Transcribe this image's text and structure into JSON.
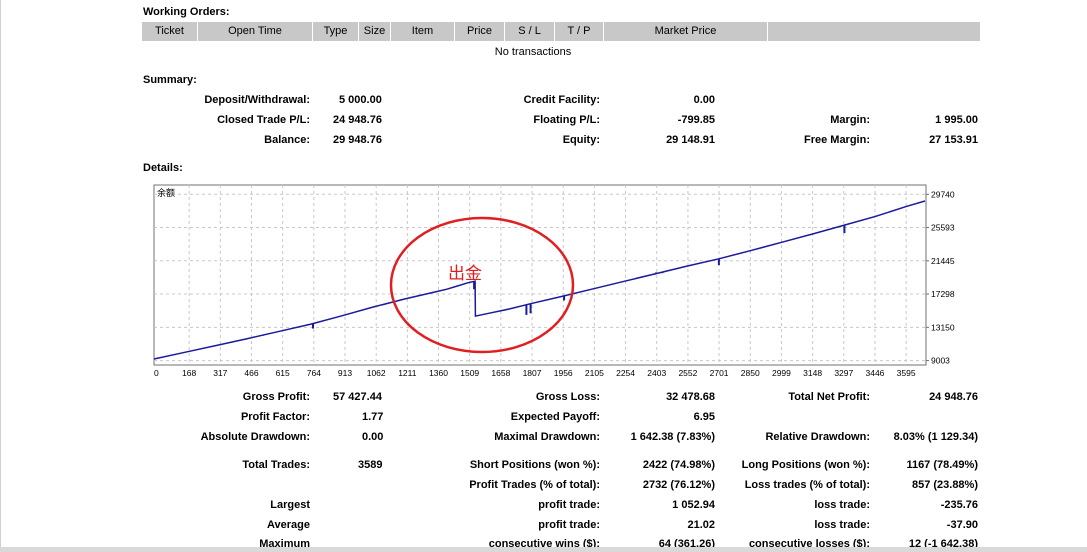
{
  "working_orders": {
    "title": "Working Orders:",
    "columns": [
      "Ticket",
      "Open Time",
      "Type",
      "Size",
      "Item",
      "Price",
      "S / L",
      "T / P",
      "Market Price",
      ""
    ],
    "empty_text": "No transactions"
  },
  "summary": {
    "title": "Summary:",
    "deposit_label": "Deposit/Withdrawal:",
    "deposit_value": "5 000.00",
    "credit_label": "Credit Facility:",
    "credit_value": "0.00",
    "closed_label": "Closed Trade P/L:",
    "closed_value": "24 948.76",
    "floating_label": "Floating P/L:",
    "floating_value": "-799.85",
    "margin_label": "Margin:",
    "margin_value": "1 995.00",
    "balance_label": "Balance:",
    "balance_value": "29 948.76",
    "equity_label": "Equity:",
    "equity_value": "29 148.91",
    "free_margin_label": "Free Margin:",
    "free_margin_value": "27 153.91"
  },
  "details": {
    "title": "Details:",
    "gross_profit_label": "Gross Profit:",
    "gross_profit_value": "57 427.44",
    "gross_loss_label": "Gross Loss:",
    "gross_loss_value": "32 478.68",
    "total_net_profit_label": "Total Net Profit:",
    "total_net_profit_value": "24 948.76",
    "profit_factor_label": "Profit Factor:",
    "profit_factor_value": "1.77",
    "expected_payoff_label": "Expected Payoff:",
    "expected_payoff_value": "6.95",
    "abs_drawdown_label": "Absolute Drawdown:",
    "abs_drawdown_value": "0.00",
    "max_drawdown_label": "Maximal Drawdown:",
    "max_drawdown_value": "1 642.38 (7.83%)",
    "rel_drawdown_label": "Relative Drawdown:",
    "rel_drawdown_value": "8.03% (1 129.34)",
    "total_trades_label": "Total Trades:",
    "total_trades_value": "3589",
    "short_label": "Short Positions (won %):",
    "short_value": "2422 (74.98%)",
    "long_label": "Long Positions (won %):",
    "long_value": "1167 (78.49%)",
    "profit_trades_label": "Profit Trades (% of total):",
    "profit_trades_value": "2732 (76.12%)",
    "loss_trades_label": "Loss trades (% of total):",
    "loss_trades_value": "857 (23.88%)",
    "largest_label": "Largest",
    "largest_profit_label": "profit trade:",
    "largest_profit_value": "1 052.94",
    "largest_loss_label": "loss trade:",
    "largest_loss_value": "-235.76",
    "average_label": "Average",
    "average_profit_label": "profit trade:",
    "average_profit_value": "21.02",
    "average_loss_label": "loss trade:",
    "average_loss_value": "-37.90",
    "maximum_label": "Maximum",
    "max_wins_label": "consecutive wins ($):",
    "max_wins_value": "64 (361.26)",
    "max_losses_label": "consecutive losses ($):",
    "max_losses_value": "12 (-1 642.38)"
  },
  "chart_data": {
    "type": "line",
    "title": "",
    "legend_text": "余额",
    "annotation": "出金",
    "x_ticks": [
      0,
      168,
      317,
      466,
      615,
      764,
      913,
      1062,
      1211,
      1360,
      1509,
      1658,
      1807,
      1956,
      2105,
      2254,
      2403,
      2552,
      2701,
      2850,
      2999,
      3148,
      3297,
      3446,
      3595
    ],
    "y_ticks": [
      9003,
      13150,
      17298,
      21445,
      25593,
      29740
    ],
    "xlim": [
      0,
      3690
    ],
    "ylim": [
      8450,
      30900
    ],
    "grid": true,
    "series": [
      {
        "x": [
          0,
          150,
          300,
          450,
          600,
          750,
          900,
          1050,
          1200,
          1350,
          1400,
          1450,
          1500,
          1535,
          1536,
          1600,
          1700,
          1800,
          1950,
          2100,
          2250,
          2400,
          2550,
          2700,
          2850,
          3000,
          3150,
          3300,
          3450,
          3600,
          3685
        ],
        "y": [
          9200,
          10050,
          10900,
          11750,
          12650,
          13550,
          14600,
          15700,
          16700,
          17600,
          17900,
          18300,
          18700,
          18900,
          14550,
          14900,
          15450,
          16100,
          17000,
          17950,
          18900,
          19850,
          20800,
          21700,
          22700,
          23750,
          24800,
          25900,
          27000,
          28250,
          28900
        ]
      }
    ],
    "dips": [
      {
        "x": 520,
        "to": 12100
      },
      {
        "x": 760,
        "to": 13000
      },
      {
        "x": 1530,
        "to": 17900
      },
      {
        "x": 1780,
        "to": 14700
      },
      {
        "x": 1800,
        "to": 14900
      },
      {
        "x": 1960,
        "to": 16500
      },
      {
        "x": 2400,
        "to": 20000
      },
      {
        "x": 2430,
        "to": 19900
      },
      {
        "x": 2700,
        "to": 20900
      },
      {
        "x": 2960,
        "to": 23400
      },
      {
        "x": 3300,
        "to": 24900
      }
    ],
    "colors": {
      "line": "#1a1a9c",
      "grid": "#c8c8c8",
      "annotation": "#e02020"
    }
  }
}
